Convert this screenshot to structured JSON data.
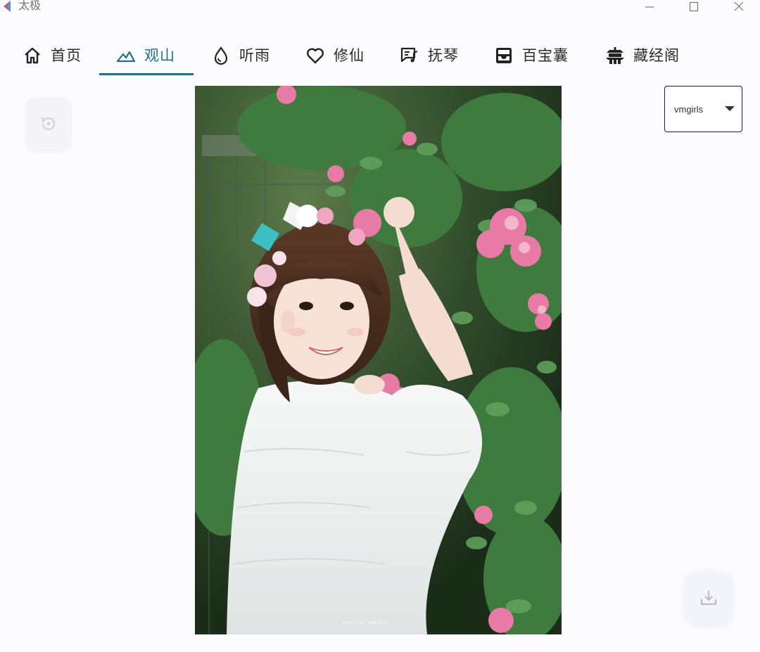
{
  "app": {
    "title": "太极"
  },
  "window_controls": {
    "minimize_icon": "minimize-icon",
    "maximize_icon": "maximize-icon",
    "close_icon": "close-icon"
  },
  "nav": {
    "active_index": 1,
    "accent_color": "#1f6f8f",
    "tabs": [
      {
        "label": "首页",
        "icon": "home-icon"
      },
      {
        "label": "观山",
        "icon": "mountain-icon"
      },
      {
        "label": "听雨",
        "icon": "water-drop-icon"
      },
      {
        "label": "修仙",
        "icon": "heart-icon"
      },
      {
        "label": "抚琴",
        "icon": "music-note-icon"
      },
      {
        "label": "百宝囊",
        "icon": "inbox-icon"
      },
      {
        "label": "藏经阁",
        "icon": "temple-icon"
      }
    ]
  },
  "gallery": {
    "reset_icon": "history-reset-icon",
    "photo_icon": "photo",
    "source_select": {
      "value": "vmgirls",
      "caret_icon": "caret-down-icon"
    },
    "download_icon": "download-icon"
  }
}
